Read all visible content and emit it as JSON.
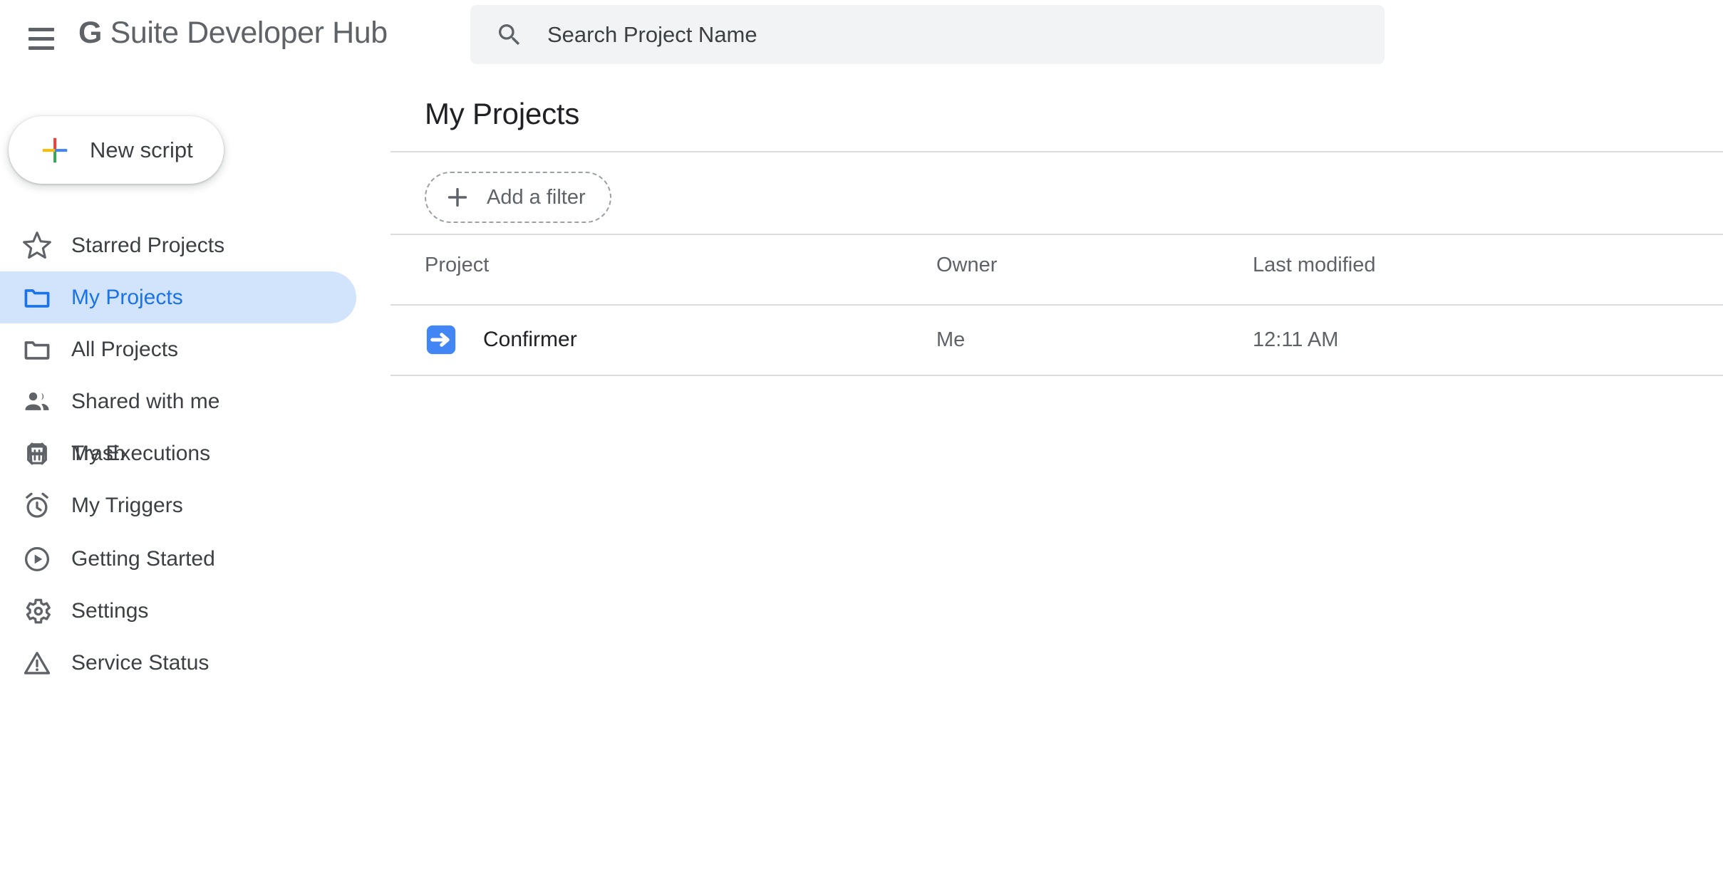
{
  "header": {
    "menu_icon": "hamburger-menu-icon",
    "brand_g": "G",
    "brand_rest": " Suite Developer Hub",
    "brand_full": "G Suite Developer Hub"
  },
  "search": {
    "icon": "search-icon",
    "placeholder": "Search Project Name",
    "value": ""
  },
  "sidebar": {
    "new_script": {
      "label": "New script",
      "icon": "google-plus-icon"
    },
    "group1": [
      {
        "label": "Starred Projects",
        "icon": "star-icon",
        "active": false
      },
      {
        "label": "My Projects",
        "icon": "folder-icon",
        "active": true
      },
      {
        "label": "All Projects",
        "icon": "folder-icon",
        "active": false
      },
      {
        "label": "Shared with me",
        "icon": "people-icon",
        "active": false
      },
      {
        "label": "Trash",
        "icon": "trash-icon",
        "active": false
      }
    ],
    "group2": [
      {
        "label": "My Executions",
        "icon": "executions-brackets-icon",
        "active": false
      },
      {
        "label": "My Triggers",
        "icon": "alarm-clock-icon",
        "active": false
      }
    ],
    "group3": [
      {
        "label": "Getting Started",
        "icon": "play-circle-icon",
        "active": false
      },
      {
        "label": "Settings",
        "icon": "gear-icon",
        "active": false
      },
      {
        "label": "Service Status",
        "icon": "warning-triangle-icon",
        "active": false
      }
    ]
  },
  "main": {
    "title": "My Projects",
    "filter": {
      "label": "Add a filter",
      "icon": "plus-icon"
    },
    "table": {
      "columns": [
        "Project",
        "Owner",
        "Last modified"
      ],
      "rows": [
        {
          "project": "Confirmer",
          "project_icon": "apps-script-arrow-icon",
          "owner": "Me",
          "modified": "12:11 AM"
        }
      ]
    }
  },
  "colors": {
    "accent_blue": "#1a73e8",
    "selected_pill": "#d2e3fc",
    "script_icon_blue": "#4285f4",
    "text_primary": "#202124",
    "text_secondary": "#5f6368",
    "divider": "#dadce0",
    "search_bg": "#f1f3f4",
    "google_red": "#ea4335",
    "google_yellow": "#fbbc04",
    "google_green": "#34a853",
    "google_blue": "#4285f4"
  }
}
